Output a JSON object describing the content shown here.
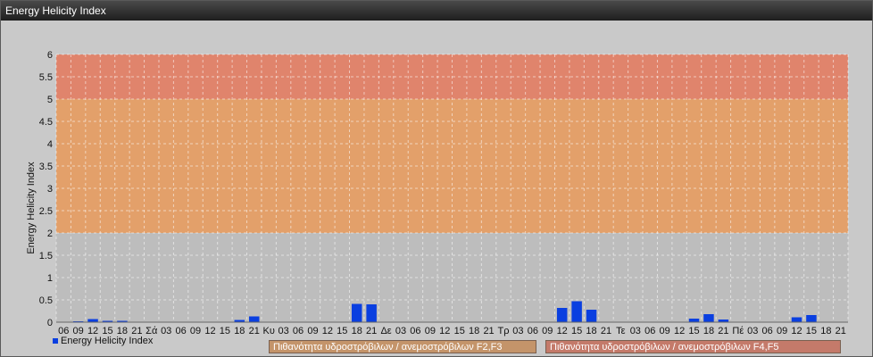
{
  "window": {
    "title": "Energy Helicity Index"
  },
  "chart_data": {
    "type": "bar",
    "title": "Energy Helicity Index",
    "ylabel": "Energy Helicity Index",
    "ylim": [
      0,
      6
    ],
    "yticks": [
      "0",
      "0.5",
      "1",
      "1.5",
      "2",
      "2.5",
      "3",
      "3.5",
      "4",
      "4.5",
      "5",
      "5.5",
      "6"
    ],
    "grid": true,
    "categories": [
      "06",
      "09",
      "12",
      "15",
      "18",
      "21",
      "Σά",
      "03",
      "06",
      "09",
      "12",
      "15",
      "18",
      "21",
      "Κυ",
      "03",
      "06",
      "09",
      "12",
      "15",
      "18",
      "21",
      "Δε",
      "03",
      "06",
      "09",
      "12",
      "15",
      "18",
      "21",
      "Τρ",
      "03",
      "06",
      "09",
      "12",
      "15",
      "18",
      "21",
      "Τε",
      "03",
      "06",
      "09",
      "12",
      "15",
      "18",
      "21",
      "Πέ",
      "03",
      "06",
      "09",
      "12",
      "15",
      "18",
      "21"
    ],
    "series": [
      {
        "name": "Energy Helicity Index",
        "color": "#0a3fe0",
        "values": [
          0.01,
          0.02,
          0.07,
          0.03,
          0.03,
          0.01,
          0.01,
          0.01,
          0.01,
          0.01,
          0.01,
          0.01,
          0.05,
          0.13,
          0.01,
          0.01,
          0.01,
          0.01,
          0.01,
          0.01,
          0.41,
          0.4,
          0.01,
          0.01,
          0.01,
          0.01,
          0.01,
          0.01,
          0.01,
          0.01,
          0.01,
          0.01,
          0.01,
          0.01,
          0.32,
          0.47,
          0.28,
          0.01,
          0.01,
          0.01,
          0.01,
          0.01,
          0.01,
          0.08,
          0.18,
          0.06,
          0.01,
          0.01,
          0.01,
          0.01,
          0.11,
          0.16,
          0.01,
          0.01
        ]
      }
    ],
    "bands": [
      {
        "label": "Πιθανότητα υδροστρόβιλων / ανεμοστρόβιλων F2,F3",
        "from": 2,
        "to": 5,
        "color": "#e3a06a"
      },
      {
        "label": "Πιθανότητα υδροστρόβιλων / ανεμοστρόβιλων F4,F5",
        "from": 5,
        "to": 6,
        "color": "#e0846c"
      }
    ],
    "legend": "bottom-left"
  }
}
